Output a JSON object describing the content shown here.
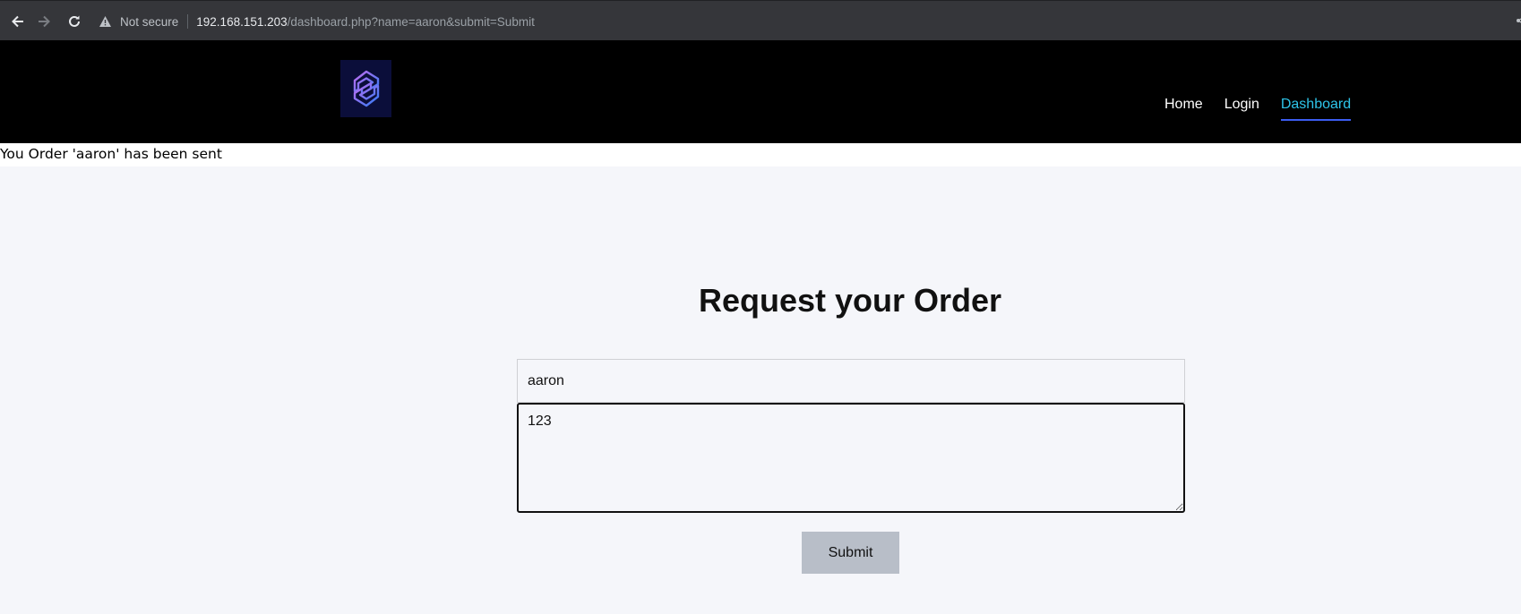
{
  "browser": {
    "security_label": "Not secure",
    "url_host": "192.168.151.203",
    "url_path": "/dashboard.php?name=aaron&submit=Submit"
  },
  "header": {
    "nav": [
      {
        "label": "Home",
        "active": false
      },
      {
        "label": "Login",
        "active": false
      },
      {
        "label": "Dashboard",
        "active": true
      }
    ]
  },
  "status_message": "You Order 'aaron' has been sent",
  "form": {
    "title": "Request your Order",
    "name_value": "aaron",
    "message_value": "123",
    "submit_label": "Submit"
  },
  "colors": {
    "active_nav": "#2ec4e8",
    "active_underline": "#3b5cf0",
    "button_bg": "#b8bec8",
    "header_bg": "#000000",
    "page_bg": "#f5f6fa"
  }
}
